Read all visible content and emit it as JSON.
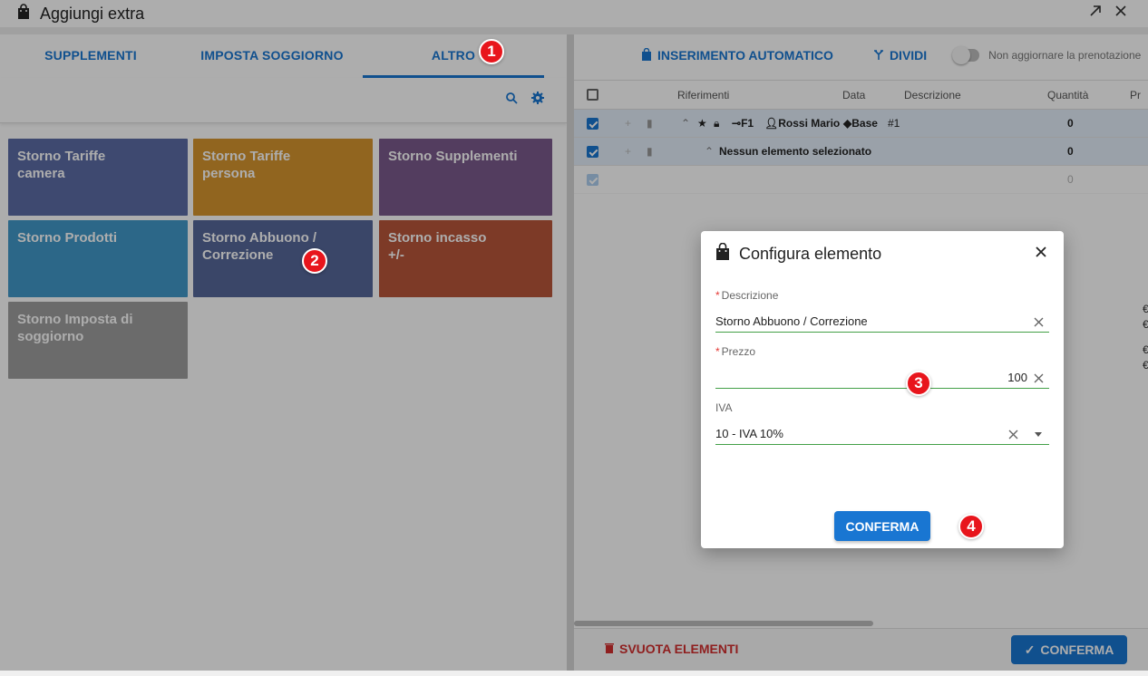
{
  "window": {
    "title": "Aggiungi extra"
  },
  "left": {
    "tabs": [
      {
        "label": "SUPPLEMENTI"
      },
      {
        "label": "IMPOSTA SOGGIORNO"
      },
      {
        "label": "ALTRO"
      }
    ],
    "active_tab": "ALTRO",
    "tiles": [
      {
        "label": "Storno Tariffe camera",
        "line1": "Storno Tariffe",
        "line2": "camera",
        "color": "#5c6ca6"
      },
      {
        "label": "Storno Tariffe persona",
        "line1": "Storno Tariffe",
        "line2": "persona",
        "color": "#d6952f"
      },
      {
        "label": "Storno Supplementi",
        "line1": "Storno Supplementi",
        "line2": "",
        "color": "#7b5a8c"
      },
      {
        "label": "Storno Prodotti",
        "line1": "Storno Prodotti",
        "line2": "",
        "color": "#4199c9"
      },
      {
        "label": "Storno Abbuono / Correzione",
        "line1": "Storno Abbuono /",
        "line2": "Correzione",
        "color": "#56679a"
      },
      {
        "label": "Storno incasso +/-",
        "line1": "Storno incasso",
        "line2": "+/-",
        "color": "#b9563a"
      },
      {
        "label": "Storno Imposta di soggiorno",
        "line1": "Storno Imposta di",
        "line2": "soggiorno",
        "color": "#9e9e9e"
      }
    ]
  },
  "right": {
    "toolbar": {
      "auto_insert": "INSERIMENTO AUTOMATICO",
      "split": "DIVIDI",
      "toggle_label": "Non aggiornare la prenotazione"
    },
    "columns": {
      "riferimenti": "Riferimenti",
      "data": "Data",
      "descrizione": "Descrizione",
      "quantita": "Quantità",
      "pr": "Pr"
    },
    "rows": [
      {
        "room": "F1",
        "guest": "Rossi Mario",
        "tariff": "Base",
        "num": "#1",
        "qty": "0"
      },
      {
        "desc": "Nessun elemento selezionato",
        "qty": "0"
      },
      {
        "qty": "0"
      }
    ],
    "edge_symbols": [
      "€",
      "€",
      "€",
      "€"
    ],
    "footer": {
      "clear": "SVUOTA ELEMENTI",
      "confirm": "CONFERMA"
    }
  },
  "dialog": {
    "title": "Configura elemento",
    "fields": {
      "descrizione": {
        "label": "Descrizione",
        "value": "Storno Abbuono / Correzione",
        "required": true
      },
      "prezzo": {
        "label": "Prezzo",
        "value": "100",
        "required": true
      },
      "iva": {
        "label": "IVA",
        "value": "10 - IVA 10%",
        "required": false
      }
    },
    "confirm_label": "CONFERMA"
  },
  "markers": [
    "1",
    "2",
    "3",
    "4"
  ],
  "colors": {
    "accent": "#1976d2",
    "danger": "#d32f2f",
    "marker": "#e8151c",
    "field_underline": "#43a047"
  }
}
